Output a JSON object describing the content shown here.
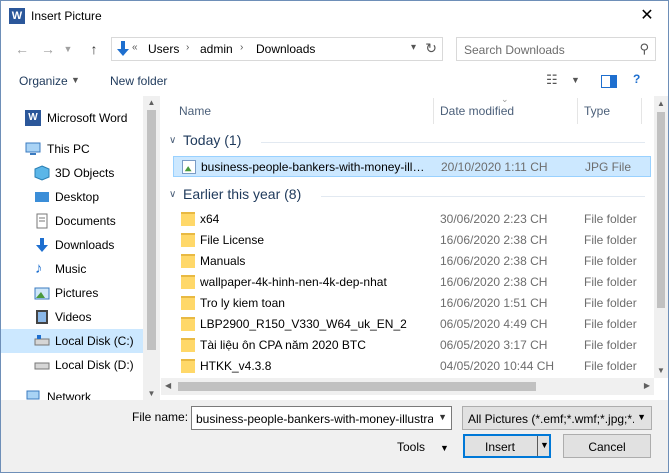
{
  "window": {
    "title": "Insert Picture",
    "app_icon_letter": "W",
    "close_glyph": "✕"
  },
  "address": {
    "overflow": "«",
    "crumbs": [
      "Users",
      "admin",
      "Downloads"
    ]
  },
  "search": {
    "placeholder": "Search Downloads"
  },
  "toolbar": {
    "organize": "Organize",
    "new_folder": "New folder"
  },
  "sidebar": {
    "items": [
      {
        "label": "Microsoft Word",
        "icon": "word-icon"
      },
      {
        "label": "This PC",
        "icon": "pc-icon"
      },
      {
        "label": "3D Objects",
        "icon": "cube-icon"
      },
      {
        "label": "Desktop",
        "icon": "desktop-icon"
      },
      {
        "label": "Documents",
        "icon": "document-icon"
      },
      {
        "label": "Downloads",
        "icon": "download-icon"
      },
      {
        "label": "Music",
        "icon": "music-icon"
      },
      {
        "label": "Pictures",
        "icon": "pictures-icon"
      },
      {
        "label": "Videos",
        "icon": "video-icon"
      },
      {
        "label": "Local Disk (C:)",
        "icon": "drive-icon"
      },
      {
        "label": "Local Disk (D:)",
        "icon": "drive-icon"
      },
      {
        "label": "Network",
        "icon": "network-icon"
      }
    ]
  },
  "columns": {
    "name": "Name",
    "date": "Date modified",
    "type": "Type"
  },
  "groups": {
    "today": "Today (1)",
    "earlier": "Earlier this year (8)"
  },
  "today_files": [
    {
      "name": "business-people-bankers-with-money-illustration",
      "date": "20/10/2020 1:11 CH",
      "type": "JPG File"
    }
  ],
  "earlier_files": [
    {
      "name": "x64",
      "date": "30/06/2020 2:23 CH",
      "type": "File folder"
    },
    {
      "name": "File License",
      "date": "16/06/2020 2:38 CH",
      "type": "File folder"
    },
    {
      "name": "Manuals",
      "date": "16/06/2020 2:38 CH",
      "type": "File folder"
    },
    {
      "name": "wallpaper-4k-hinh-nen-4k-dep-nhat",
      "date": "16/06/2020 2:38 CH",
      "type": "File folder"
    },
    {
      "name": "Tro ly kiem toan",
      "date": "16/06/2020 1:51 CH",
      "type": "File folder"
    },
    {
      "name": "LBP2900_R150_V330_W64_uk_EN_2",
      "date": "06/05/2020 4:49 CH",
      "type": "File folder"
    },
    {
      "name": "Tài liệu ôn CPA năm 2020 BTC",
      "date": "06/05/2020 3:17 CH",
      "type": "File folder"
    },
    {
      "name": "HTKK_v4.3.8",
      "date": "04/05/2020 10:44 CH",
      "type": "File folder"
    }
  ],
  "footer": {
    "file_name_label": "File name:",
    "file_name_value": "business-people-bankers-with-money-illustration",
    "filter_value": "All Pictures (*.emf;*.wmf;*.jpg;*.jpeg;*.png)",
    "tools": "Tools",
    "insert": "Insert",
    "cancel": "Cancel"
  }
}
